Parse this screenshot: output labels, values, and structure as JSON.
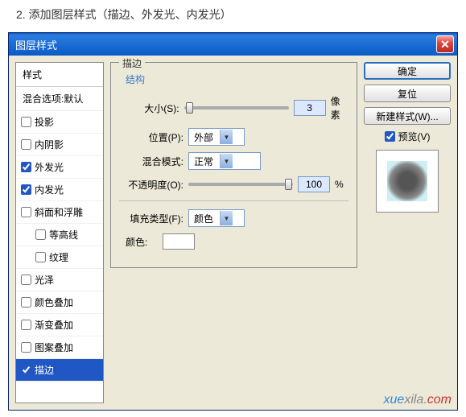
{
  "instruction": "2. 添加图层样式（描边、外发光、内发光）",
  "dialog": {
    "title": "图层样式"
  },
  "styles": {
    "header": "样式",
    "subheader": "混合选项:默认",
    "items": [
      {
        "label": "投影",
        "checked": false
      },
      {
        "label": "内阴影",
        "checked": false
      },
      {
        "label": "外发光",
        "checked": true
      },
      {
        "label": "内发光",
        "checked": true
      },
      {
        "label": "斜面和浮雕",
        "checked": false
      },
      {
        "label": "等高线",
        "checked": false,
        "indent": true
      },
      {
        "label": "纹理",
        "checked": false,
        "indent": true
      },
      {
        "label": "光泽",
        "checked": false
      },
      {
        "label": "颜色叠加",
        "checked": false
      },
      {
        "label": "渐变叠加",
        "checked": false
      },
      {
        "label": "图案叠加",
        "checked": false
      },
      {
        "label": "描边",
        "checked": true,
        "selected": true
      }
    ]
  },
  "stroke": {
    "legend": "描边",
    "structure": "结构",
    "size_label": "大小(S):",
    "size_value": "3",
    "size_unit": "像素",
    "position_label": "位置(P):",
    "position_value": "外部",
    "blend_label": "混合模式:",
    "blend_value": "正常",
    "opacity_label": "不透明度(O):",
    "opacity_value": "100",
    "opacity_unit": "%",
    "filltype_label": "填充类型(F):",
    "filltype_value": "颜色",
    "color_label": "颜色:"
  },
  "buttons": {
    "ok": "确定",
    "reset": "复位",
    "newstyle": "新建样式(W)...",
    "preview": "预览(V)"
  },
  "watermark": {
    "p1": "xue",
    "p2": "xila.",
    "p3": "com"
  }
}
